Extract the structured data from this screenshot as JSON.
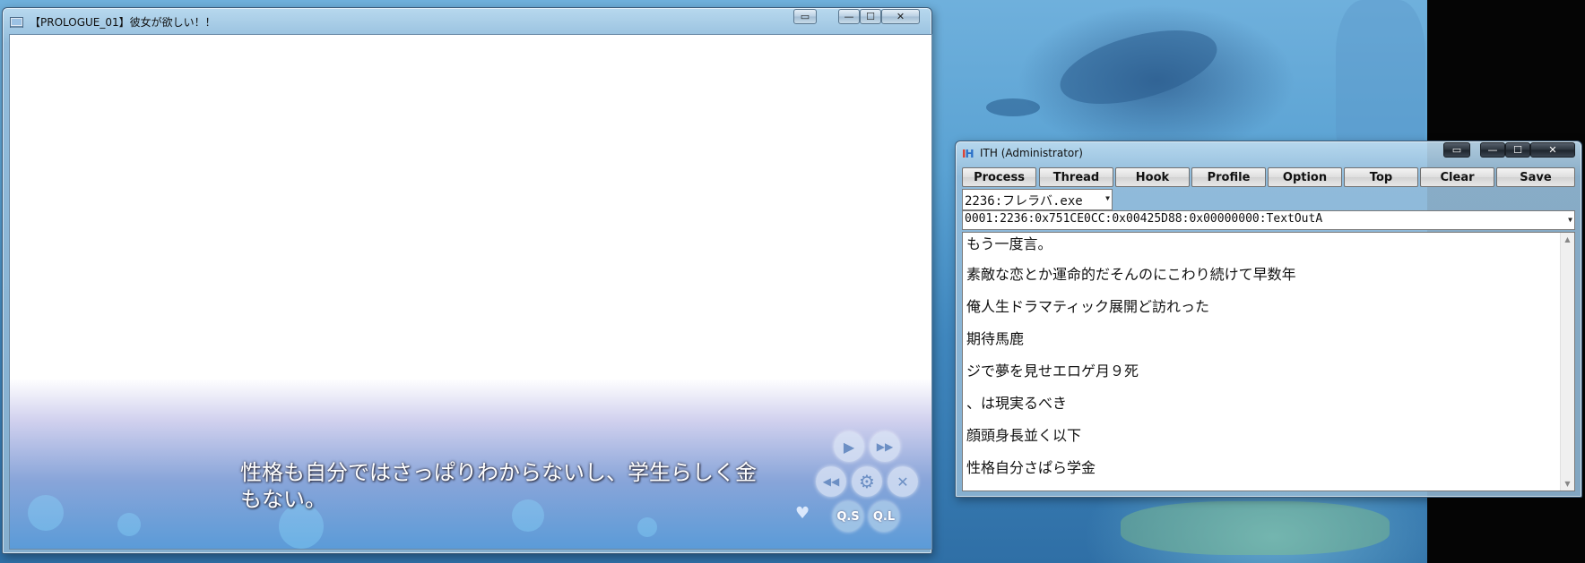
{
  "game_window": {
    "title": "【PROLOGUE_01】彼女が欲しい！！",
    "caption_buttons": {
      "extra": "▭",
      "minimize": "—",
      "maximize": "☐",
      "close": "✕"
    },
    "message_line1": "性格も自分ではさっぱりわからないし、学生らしく金",
    "message_line2": "もない。",
    "controls": {
      "play": "▶",
      "fast_forward": "▶▶",
      "rewind": "◀◀",
      "config": "⚙",
      "close": "✕",
      "quick_save": "Q.S",
      "quick_load": "Q.L",
      "heart": "♥"
    }
  },
  "ith_window": {
    "title": "ITH (Administrator)",
    "icon_label": "IH",
    "caption_buttons": {
      "extra": "▭",
      "minimize": "—",
      "maximize": "☐",
      "close": "✕"
    },
    "toolbar": [
      "Process",
      "Thread",
      "Hook",
      "Profile",
      "Option",
      "Top",
      "Clear",
      "Save"
    ],
    "process_combo": "2236:フレラバ.exe",
    "thread_combo": "0001:2236:0x751CE0CC:0x00425D88:0x00000000:TextOutA",
    "text_lines": [
      "もう一度言。",
      "素敵な恋とか運命的だそんのにこわり続けて早数年",
      "俺人生ドラマティック展開ど訪れった",
      "期待馬鹿",
      "ジで夢を見せエロゲ月９死",
      "、は現実るべき",
      "顔頭身長並く以下",
      "性格自分さぱら学金"
    ]
  },
  "colors": {
    "desktop_blue": "#5aa2d3",
    "message_blue": "#5b9bd8",
    "close_red": "#c8553a"
  }
}
